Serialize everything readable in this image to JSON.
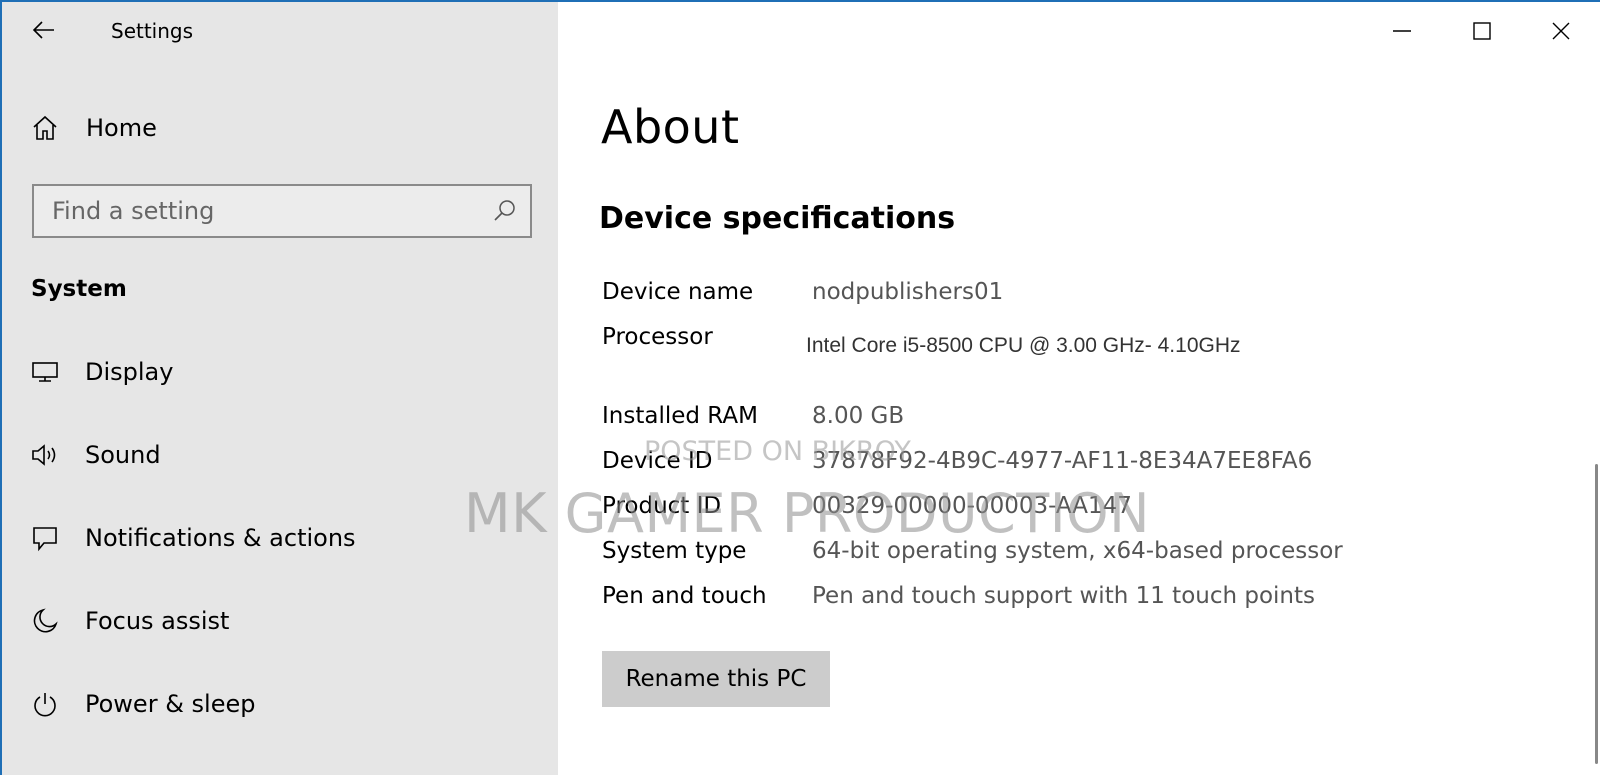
{
  "window": {
    "accent": "#1f6fb6"
  },
  "titlebar": {
    "app_title": "Settings",
    "back_icon": "arrow-left-icon",
    "minimize_icon": "minimize-icon",
    "maximize_icon": "maximize-icon",
    "close_icon": "close-icon"
  },
  "sidebar": {
    "home_label": "Home",
    "search_placeholder": "Find a setting",
    "group_heading": "System",
    "items": [
      {
        "label": "Display",
        "icon": "monitor-icon"
      },
      {
        "label": "Sound",
        "icon": "speaker-icon"
      },
      {
        "label": "Notifications & actions",
        "icon": "notification-icon"
      },
      {
        "label": "Focus assist",
        "icon": "moon-icon"
      },
      {
        "label": "Power & sleep",
        "icon": "power-icon"
      }
    ]
  },
  "main": {
    "page_title": "About",
    "section_title": "Device specifications",
    "specs": [
      {
        "label": "Device name",
        "value": "nodpublishers01"
      },
      {
        "label": "Processor",
        "value": "Intel Core i5-8500 CPU @ 3.00 GHz- 4.10GHz"
      },
      {
        "label": "Installed RAM",
        "value": "8.00 GB"
      },
      {
        "label": "Device ID",
        "value": "37878F92-4B9C-4977-AF11-8E34A7EE8FA6"
      },
      {
        "label": "Product ID",
        "value": "00329-00000-00003-AA147"
      },
      {
        "label": "System type",
        "value": "64-bit operating system, x64-based processor"
      },
      {
        "label": "Pen and touch",
        "value": "Pen and touch support with 11 touch points"
      }
    ],
    "rename_button": "Rename this PC"
  },
  "watermarks": {
    "small": "POSTED ON BIKROY",
    "big": "MK GAMER PRODUCTION"
  }
}
